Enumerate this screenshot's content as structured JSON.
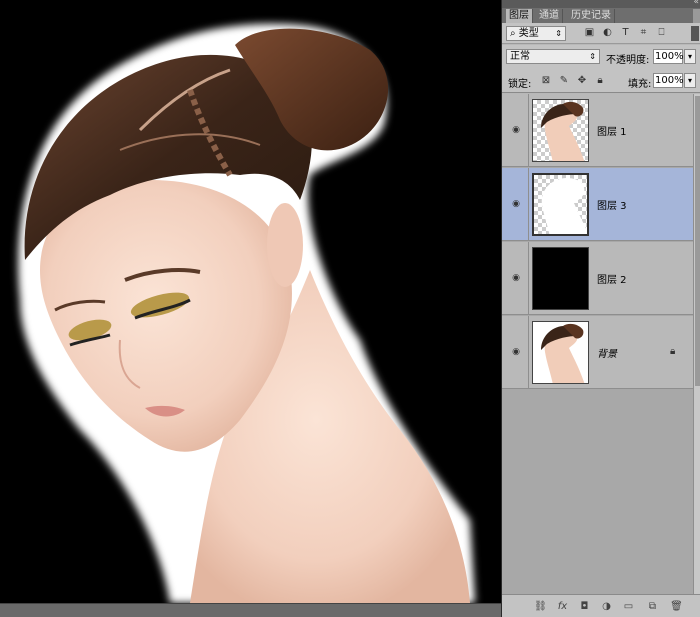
{
  "tabs": [
    {
      "label": "图层"
    },
    {
      "label": "通道"
    },
    {
      "label": "历史记录"
    }
  ],
  "filter": {
    "kind_label": "类型",
    "icons": [
      "image-icon",
      "adjustment-icon",
      "text-icon",
      "shape-icon",
      "smart-object-icon"
    ]
  },
  "blend": {
    "mode": "正常",
    "opacity_label": "不透明度:",
    "opacity_value": "100%"
  },
  "lock": {
    "label": "锁定:",
    "fill_label": "填充:",
    "fill_value": "100%"
  },
  "layers": [
    {
      "name": "图层 1",
      "thumb": "portrait-transparent",
      "visible": true,
      "selected": false
    },
    {
      "name": "图层 3",
      "thumb": "white-silhouette",
      "visible": true,
      "selected": true
    },
    {
      "name": "图层 2",
      "thumb": "black-fill",
      "visible": true,
      "selected": false
    },
    {
      "name": "背景",
      "thumb": "portrait-white-bg",
      "visible": true,
      "selected": false,
      "locked": true
    }
  ],
  "colors": {
    "selection": "#a5b5d9",
    "panel": "#b8b8b8",
    "canvas": "#000000"
  }
}
